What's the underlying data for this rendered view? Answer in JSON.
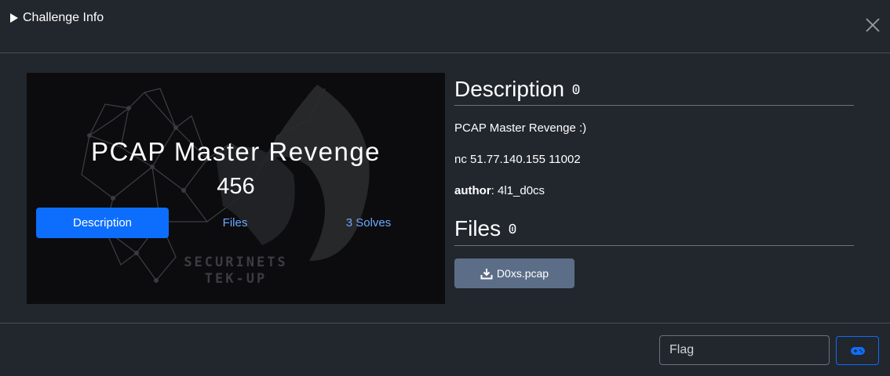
{
  "modal": {
    "title": "Challenge Info"
  },
  "challenge": {
    "name": "PCAP Master Revenge",
    "points": "456",
    "banner_text_line1": "SECURINETS",
    "banner_text_line2": "TEK-UP"
  },
  "tabs": [
    {
      "label": "Description",
      "active": true
    },
    {
      "label": "Files",
      "active": false
    },
    {
      "label": "3 Solves",
      "active": false
    }
  ],
  "description": {
    "heading": "Description",
    "text": "PCAP Master Revenge :)",
    "connection": "nc 51.77.140.155 11002",
    "author_label": "author",
    "author_value": ": 4l1_d0cs"
  },
  "files": {
    "heading": "Files",
    "items": [
      {
        "name": "D0xs.pcap"
      }
    ]
  },
  "flag_form": {
    "placeholder": "Flag",
    "submit_icon": "gamepad-icon"
  },
  "colors": {
    "background": "#22262d",
    "accent": "#0d6efd",
    "link": "#6ea8fe",
    "file_button": "#5c6e87"
  }
}
